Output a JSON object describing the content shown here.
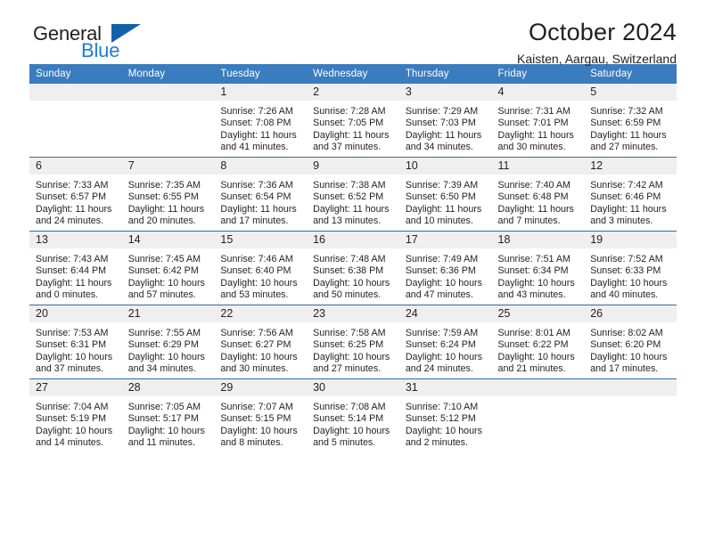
{
  "brand": {
    "name_part1": "General",
    "name_part2": "Blue",
    "triangle_color": "#1361a8",
    "blue_color": "#1b7fd4"
  },
  "header": {
    "title": "October 2024",
    "subtitle": "Kaisten, Aargau, Switzerland",
    "header_bg": "#3a7cbe",
    "row_divider": "#2f6ca8",
    "daynum_bg": "#efefef"
  },
  "weekday_headers": [
    "Sunday",
    "Monday",
    "Tuesday",
    "Wednesday",
    "Thursday",
    "Friday",
    "Saturday"
  ],
  "labels": {
    "sunrise_prefix": "Sunrise:",
    "sunset_prefix": "Sunset:",
    "daylight_prefix": "Daylight:"
  },
  "weeks": [
    [
      {
        "day": "",
        "line1": "",
        "line2": "",
        "line3": "",
        "line4": ""
      },
      {
        "day": "",
        "line1": "",
        "line2": "",
        "line3": "",
        "line4": ""
      },
      {
        "day": "1",
        "line1": "Sunrise: 7:26 AM",
        "line2": "Sunset: 7:08 PM",
        "line3": "Daylight: 11 hours",
        "line4": "and 41 minutes."
      },
      {
        "day": "2",
        "line1": "Sunrise: 7:28 AM",
        "line2": "Sunset: 7:05 PM",
        "line3": "Daylight: 11 hours",
        "line4": "and 37 minutes."
      },
      {
        "day": "3",
        "line1": "Sunrise: 7:29 AM",
        "line2": "Sunset: 7:03 PM",
        "line3": "Daylight: 11 hours",
        "line4": "and 34 minutes."
      },
      {
        "day": "4",
        "line1": "Sunrise: 7:31 AM",
        "line2": "Sunset: 7:01 PM",
        "line3": "Daylight: 11 hours",
        "line4": "and 30 minutes."
      },
      {
        "day": "5",
        "line1": "Sunrise: 7:32 AM",
        "line2": "Sunset: 6:59 PM",
        "line3": "Daylight: 11 hours",
        "line4": "and 27 minutes."
      }
    ],
    [
      {
        "day": "6",
        "line1": "Sunrise: 7:33 AM",
        "line2": "Sunset: 6:57 PM",
        "line3": "Daylight: 11 hours",
        "line4": "and 24 minutes."
      },
      {
        "day": "7",
        "line1": "Sunrise: 7:35 AM",
        "line2": "Sunset: 6:55 PM",
        "line3": "Daylight: 11 hours",
        "line4": "and 20 minutes."
      },
      {
        "day": "8",
        "line1": "Sunrise: 7:36 AM",
        "line2": "Sunset: 6:54 PM",
        "line3": "Daylight: 11 hours",
        "line4": "and 17 minutes."
      },
      {
        "day": "9",
        "line1": "Sunrise: 7:38 AM",
        "line2": "Sunset: 6:52 PM",
        "line3": "Daylight: 11 hours",
        "line4": "and 13 minutes."
      },
      {
        "day": "10",
        "line1": "Sunrise: 7:39 AM",
        "line2": "Sunset: 6:50 PM",
        "line3": "Daylight: 11 hours",
        "line4": "and 10 minutes."
      },
      {
        "day": "11",
        "line1": "Sunrise: 7:40 AM",
        "line2": "Sunset: 6:48 PM",
        "line3": "Daylight: 11 hours",
        "line4": "and 7 minutes."
      },
      {
        "day": "12",
        "line1": "Sunrise: 7:42 AM",
        "line2": "Sunset: 6:46 PM",
        "line3": "Daylight: 11 hours",
        "line4": "and 3 minutes."
      }
    ],
    [
      {
        "day": "13",
        "line1": "Sunrise: 7:43 AM",
        "line2": "Sunset: 6:44 PM",
        "line3": "Daylight: 11 hours",
        "line4": "and 0 minutes."
      },
      {
        "day": "14",
        "line1": "Sunrise: 7:45 AM",
        "line2": "Sunset: 6:42 PM",
        "line3": "Daylight: 10 hours",
        "line4": "and 57 minutes."
      },
      {
        "day": "15",
        "line1": "Sunrise: 7:46 AM",
        "line2": "Sunset: 6:40 PM",
        "line3": "Daylight: 10 hours",
        "line4": "and 53 minutes."
      },
      {
        "day": "16",
        "line1": "Sunrise: 7:48 AM",
        "line2": "Sunset: 6:38 PM",
        "line3": "Daylight: 10 hours",
        "line4": "and 50 minutes."
      },
      {
        "day": "17",
        "line1": "Sunrise: 7:49 AM",
        "line2": "Sunset: 6:36 PM",
        "line3": "Daylight: 10 hours",
        "line4": "and 47 minutes."
      },
      {
        "day": "18",
        "line1": "Sunrise: 7:51 AM",
        "line2": "Sunset: 6:34 PM",
        "line3": "Daylight: 10 hours",
        "line4": "and 43 minutes."
      },
      {
        "day": "19",
        "line1": "Sunrise: 7:52 AM",
        "line2": "Sunset: 6:33 PM",
        "line3": "Daylight: 10 hours",
        "line4": "and 40 minutes."
      }
    ],
    [
      {
        "day": "20",
        "line1": "Sunrise: 7:53 AM",
        "line2": "Sunset: 6:31 PM",
        "line3": "Daylight: 10 hours",
        "line4": "and 37 minutes."
      },
      {
        "day": "21",
        "line1": "Sunrise: 7:55 AM",
        "line2": "Sunset: 6:29 PM",
        "line3": "Daylight: 10 hours",
        "line4": "and 34 minutes."
      },
      {
        "day": "22",
        "line1": "Sunrise: 7:56 AM",
        "line2": "Sunset: 6:27 PM",
        "line3": "Daylight: 10 hours",
        "line4": "and 30 minutes."
      },
      {
        "day": "23",
        "line1": "Sunrise: 7:58 AM",
        "line2": "Sunset: 6:25 PM",
        "line3": "Daylight: 10 hours",
        "line4": "and 27 minutes."
      },
      {
        "day": "24",
        "line1": "Sunrise: 7:59 AM",
        "line2": "Sunset: 6:24 PM",
        "line3": "Daylight: 10 hours",
        "line4": "and 24 minutes."
      },
      {
        "day": "25",
        "line1": "Sunrise: 8:01 AM",
        "line2": "Sunset: 6:22 PM",
        "line3": "Daylight: 10 hours",
        "line4": "and 21 minutes."
      },
      {
        "day": "26",
        "line1": "Sunrise: 8:02 AM",
        "line2": "Sunset: 6:20 PM",
        "line3": "Daylight: 10 hours",
        "line4": "and 17 minutes."
      }
    ],
    [
      {
        "day": "27",
        "line1": "Sunrise: 7:04 AM",
        "line2": "Sunset: 5:19 PM",
        "line3": "Daylight: 10 hours",
        "line4": "and 14 minutes."
      },
      {
        "day": "28",
        "line1": "Sunrise: 7:05 AM",
        "line2": "Sunset: 5:17 PM",
        "line3": "Daylight: 10 hours",
        "line4": "and 11 minutes."
      },
      {
        "day": "29",
        "line1": "Sunrise: 7:07 AM",
        "line2": "Sunset: 5:15 PM",
        "line3": "Daylight: 10 hours",
        "line4": "and 8 minutes."
      },
      {
        "day": "30",
        "line1": "Sunrise: 7:08 AM",
        "line2": "Sunset: 5:14 PM",
        "line3": "Daylight: 10 hours",
        "line4": "and 5 minutes."
      },
      {
        "day": "31",
        "line1": "Sunrise: 7:10 AM",
        "line2": "Sunset: 5:12 PM",
        "line3": "Daylight: 10 hours",
        "line4": "and 2 minutes."
      },
      {
        "day": "",
        "line1": "",
        "line2": "",
        "line3": "",
        "line4": ""
      },
      {
        "day": "",
        "line1": "",
        "line2": "",
        "line3": "",
        "line4": ""
      }
    ]
  ]
}
